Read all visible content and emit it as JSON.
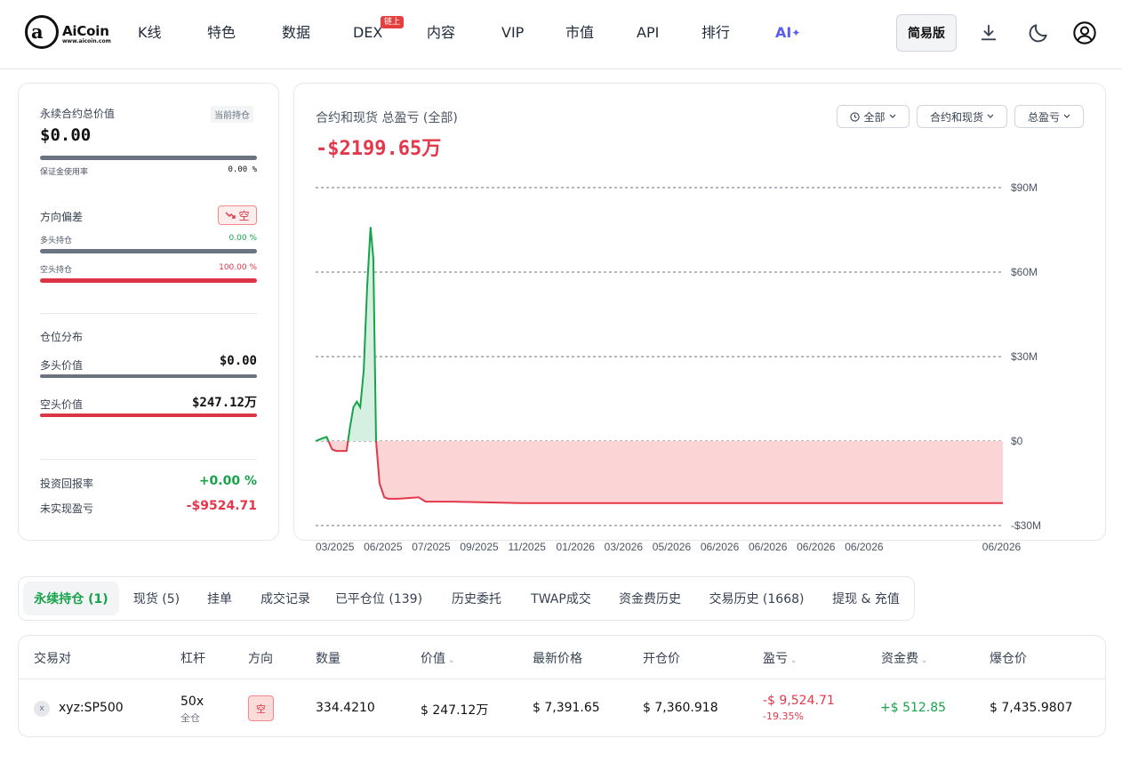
{
  "header": {
    "logo_text": "AiCoin",
    "logo_url": "www.aicoin.com",
    "nav": [
      "K线",
      "特色",
      "数据",
      "DEX",
      "内容",
      "VIP",
      "市值",
      "API",
      "排行",
      "AI"
    ],
    "dex_badge": "链上",
    "ai_spark": "✦",
    "simple_button": "简易版"
  },
  "summary": {
    "perp_total_label": "永续合约总价值",
    "current_position_tag": "当前持仓",
    "perp_total_value": "$0.00",
    "margin_usage_label": "保证金使用率",
    "margin_usage_value": "0.00 %",
    "margin_usage_fraction": 1.0,
    "bias_label": "方向偏差",
    "bias_tag": "空",
    "long_hold_label": "多头持仓",
    "long_hold_value": "0.00 %",
    "short_hold_label": "空头持仓",
    "short_hold_value": "100.00 %",
    "distribution_label": "仓位分布",
    "long_value_label": "多头价值",
    "long_value": "$0.00",
    "short_value_label": "空头价值",
    "short_value": "$247.12万",
    "roi_label": "投资回报率",
    "roi_value": "+0.00 %",
    "unrealized_label": "未实现盈亏",
    "unrealized_value": "-$9524.71"
  },
  "chart_panel": {
    "title": "合约和现货 总盈亏 (全部)",
    "total": "-$2199.65万",
    "filters": [
      "全部",
      "合约和现货",
      "总盈亏"
    ],
    "colors": {
      "positive": "#16a34a",
      "negative": "#e5374b",
      "positive_fill": "#d5f0e0",
      "negative_fill": "#fbd5d5"
    }
  },
  "chart_data": {
    "type": "area",
    "ylim": [
      -30,
      90
    ],
    "y_ticks": [
      90,
      60,
      30,
      0,
      -30
    ],
    "y_tick_labels": [
      "$90M",
      "$60M",
      "$30M",
      "$0",
      "-$30M"
    ],
    "x_tick_labels": [
      "03/2025",
      "06/2025",
      "07/2025",
      "09/2025",
      "11/2025",
      "01/2026",
      "03/2026",
      "05/2026",
      "06/2026",
      "06/2026",
      "06/2026",
      "06/2026",
      "06/2026"
    ],
    "grid": "horizontal-dashed",
    "x": [
      0,
      0.01,
      0.016,
      0.024,
      0.03,
      0.045,
      0.05,
      0.055,
      0.06,
      0.065,
      0.07,
      0.075,
      0.08,
      0.084,
      0.088,
      0.093,
      0.1,
      0.106,
      0.12,
      0.15,
      0.16,
      0.2,
      0.3,
      0.5,
      0.7,
      0.85,
      1.0
    ],
    "values": [
      0,
      1,
      1.5,
      -3,
      -3.5,
      -3.5,
      5,
      12,
      14,
      12,
      25,
      55,
      76,
      65,
      0,
      -15,
      -20,
      -20.5,
      -20.5,
      -20,
      -21.5,
      -21.5,
      -22,
      -22,
      -22,
      -22,
      -22
    ]
  },
  "tabs": [
    "永续持仓 (1)",
    "现货 (5)",
    "挂单",
    "成交记录",
    "已平仓位 (139)",
    "历史委托",
    "TWAP成交",
    "资金费历史",
    "交易历史 (1668)",
    "提现 & 充值"
  ],
  "table": {
    "headers": [
      "交易对",
      "杠杆",
      "方向",
      "数量",
      "价值",
      "最新价格",
      "开仓价",
      "盈亏",
      "资金费",
      "爆仓价"
    ],
    "row": {
      "coin_icon": "x",
      "pair": "xyz:SP500",
      "leverage": "50x",
      "margin_mode": "全仓",
      "direction": "空",
      "quantity": "334.4210",
      "value": "$ 247.12万",
      "last_price": "$ 7,391.65",
      "entry_price": "$ 7,360.918",
      "pnl": "-$ 9,524.71",
      "pnl_pct": "-19.35%",
      "funding": "+$ 512.85",
      "liq_price": "$ 7,435.9807"
    }
  }
}
